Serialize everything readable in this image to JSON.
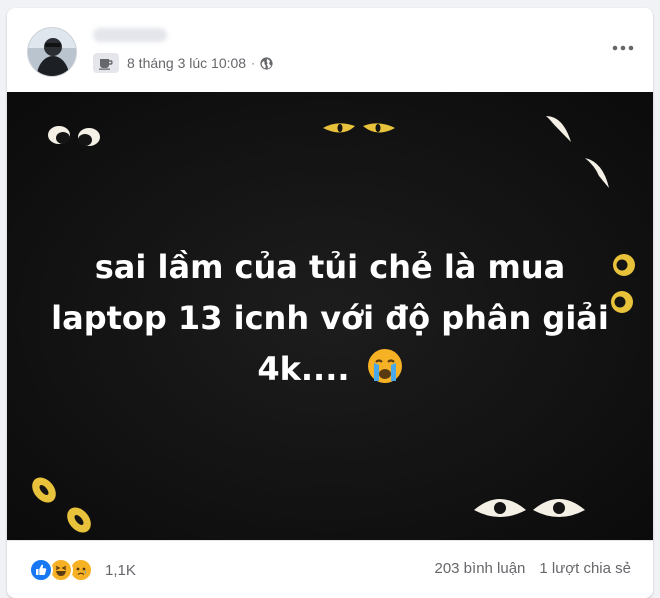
{
  "post": {
    "author_name": "Cuc Nhan",
    "timestamp": "8 tháng 3 lúc 10:08",
    "separator": "·",
    "image_text": {
      "line1": "sai lầm của tủi chẻ là mua",
      "line2": "laptop 13 icnh với độ phân giải",
      "line3": "4k....",
      "emoji": "😭"
    }
  },
  "icons": {
    "avatar": "profile-avatar",
    "activity": "coffee-cup-icon",
    "privacy": "globe-icon",
    "more": "more-options-icon",
    "reactions": [
      "like-icon",
      "haha-icon",
      "sad-icon"
    ]
  },
  "footer": {
    "reaction_count": "1,1K",
    "comments": "203 bình luận",
    "shares": "1 lượt chia sẻ"
  },
  "colors": {
    "background": "#f0f2f5",
    "card": "#ffffff",
    "image_bg": "#141414",
    "meta_text": "#65676b",
    "like_blue": "#1877f2",
    "emoji_yellow": "#f7b125",
    "eye_yellow": "#e8c23a",
    "eye_white": "#f4f0e6"
  }
}
